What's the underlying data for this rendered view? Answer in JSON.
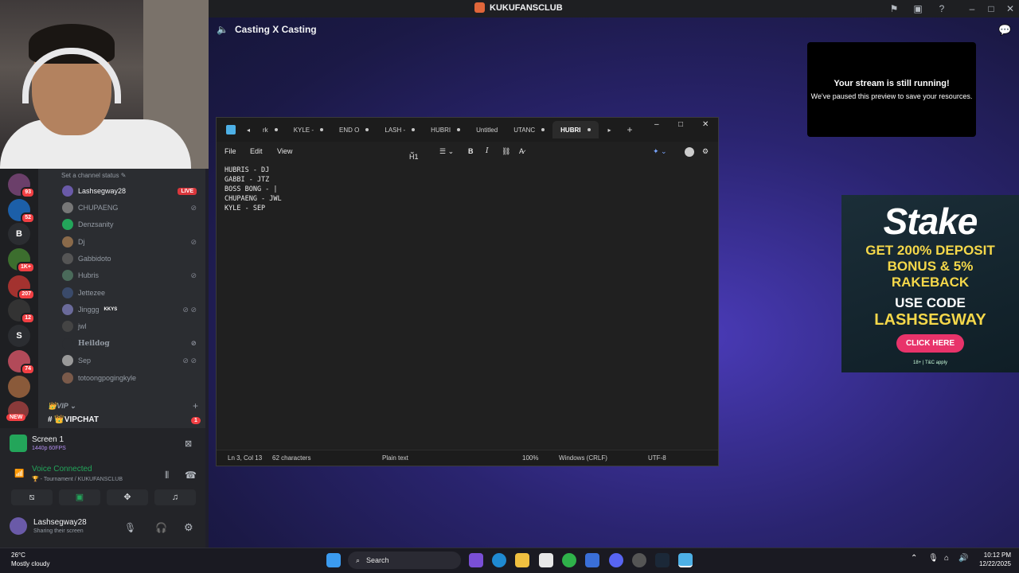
{
  "topbar": {
    "title": "KUKUFANSCLUB"
  },
  "stage": {
    "header": "Casting X Casting",
    "paused_title": "Your stream is still running!",
    "paused_sub": "We've paused this preview to save your resources."
  },
  "ad": {
    "brand": "Stake",
    "line1": "GET 200% DEPOSIT",
    "line2": "BONUS & 5%",
    "line3": "RAKEBACK",
    "use": "USE CODE",
    "code": "LASHSEGWAY",
    "button": "CLICK HERE",
    "tc": "18+ | T&C apply"
  },
  "rail": {
    "badges": [
      "93",
      "52",
      "1K+",
      "207",
      "12",
      "74"
    ],
    "letters": [
      "B",
      "S"
    ],
    "new": "NEW"
  },
  "channels": {
    "status_hint": "Set a channel status",
    "live_label": "LIVE",
    "members": [
      "Lashsegway28",
      "CHUPAENG",
      "Denzsanity",
      "Dj",
      "Gabbidoto",
      "Hubris",
      "Jettezee",
      "Jinggg",
      "jwl",
      "Heildog",
      "Sep",
      "totoongpogingkyle"
    ],
    "jinggg_tag": "KKYS",
    "vip_category": "VIP",
    "vipchat": "VIPCHAT",
    "vipchat_badge": "1"
  },
  "panel": {
    "screen_title": "Screen 1",
    "screen_sub": "1440p 60FPS",
    "voice_title": "Voice Connected",
    "voice_sub": "- Tournament / KUKUFANSCLUB",
    "user_name": "Lashsegway28",
    "user_status": "Sharing their screen"
  },
  "notepad": {
    "tabs": [
      "rk",
      "KYLE -",
      "END O",
      "LASH -",
      "HUBRI",
      "Untitled",
      "UTANC",
      "HUBRI"
    ],
    "menu": {
      "file": "File",
      "edit": "Edit",
      "view": "View",
      "heading": "H1"
    },
    "content": "HUBRIS - DJ\nGABBI - JTZ\nBOSS BONG - |\nCHUPAENG - JWL\nKYLE - SEP",
    "status": {
      "pos": "Ln 3, Col 13",
      "chars": "62 characters",
      "format": "Plain text",
      "zoom": "100%",
      "eol": "Windows (CRLF)",
      "enc": "UTF-8"
    }
  },
  "taskbar": {
    "temp": "26°C",
    "weather": "Mostly cloudy",
    "search": "Search",
    "time": "10:12 PM",
    "date": "12/22/2025"
  }
}
